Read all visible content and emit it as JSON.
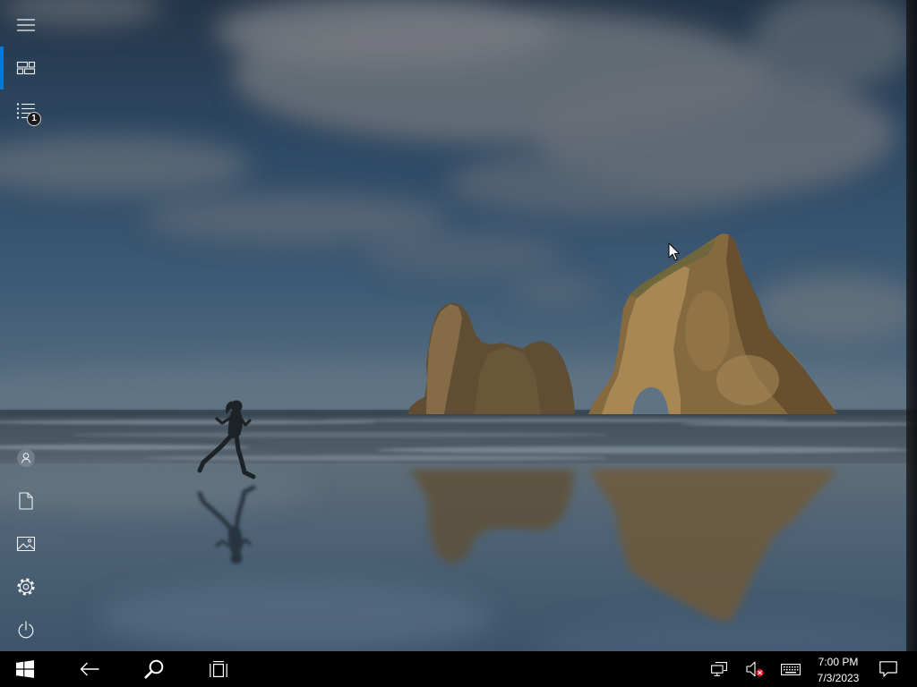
{
  "sidebar": {
    "menu_button": {
      "icon": "hamburger-menu-icon"
    },
    "pinned_tiles": {
      "icon": "tiles-icon",
      "selected": true
    },
    "all_apps": {
      "icon": "all-apps-list-icon",
      "badge": "1"
    },
    "user": {
      "icon": "user-icon"
    },
    "documents": {
      "icon": "document-icon"
    },
    "pictures": {
      "icon": "pictures-icon"
    },
    "settings": {
      "icon": "settings-gear-icon"
    },
    "power": {
      "icon": "power-icon"
    }
  },
  "taskbar": {
    "start": {
      "icon": "windows-logo-icon"
    },
    "back": {
      "icon": "back-arrow-icon"
    },
    "search": {
      "icon": "search-icon"
    },
    "task_view": {
      "icon": "task-view-icon"
    },
    "network": {
      "icon": "network-icon"
    },
    "volume": {
      "icon": "volume-muted-icon",
      "muted": true
    },
    "keyboard": {
      "icon": "touch-keyboard-icon"
    },
    "clock": {
      "time": "7:00 PM",
      "date": "7/3/2023"
    },
    "action_center": {
      "icon": "action-center-icon"
    }
  },
  "colors": {
    "accent": "#0078d7",
    "taskbar": "#000000",
    "icon": "#ffffff",
    "muted_indicator": "#e81123"
  }
}
